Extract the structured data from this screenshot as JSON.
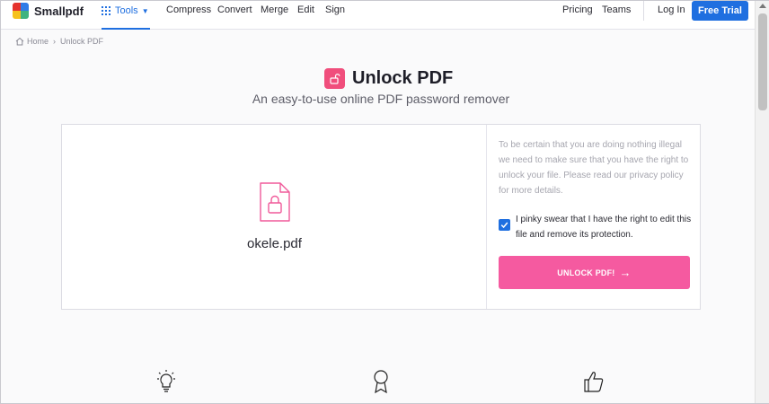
{
  "header": {
    "brand": "Smallpdf",
    "tools_label": "Tools",
    "nav": [
      "Compress",
      "Convert",
      "Merge",
      "Edit",
      "Sign"
    ],
    "right_nav": [
      "Pricing",
      "Teams"
    ],
    "login": "Log In",
    "free_trial": "Free Trial"
  },
  "breadcrumb": {
    "home": "Home",
    "current": "Unlock PDF"
  },
  "page": {
    "title": "Unlock PDF",
    "subtitle": "An easy-to-use online PDF password remover"
  },
  "file": {
    "name": "okele.pdf"
  },
  "notice": "To be certain that you are doing nothing illegal we need to make sure that you have the right to unlock your file. Please read our privacy policy for more details.",
  "consent": {
    "checked": true,
    "label": "I pinky swear that I have the right to edit this file and remove its protection."
  },
  "unlock_button": "UNLOCK PDF!",
  "colors": {
    "accent": "#1f6fe0",
    "brand_pink": "#f55aa0",
    "title_icon": "#f04e7c"
  },
  "icons": [
    "grid-icon",
    "home-icon",
    "unlock-icon",
    "file-lock-icon",
    "arrow-right-icon",
    "lightbulb-icon",
    "award-icon",
    "thumbs-up-icon"
  ]
}
